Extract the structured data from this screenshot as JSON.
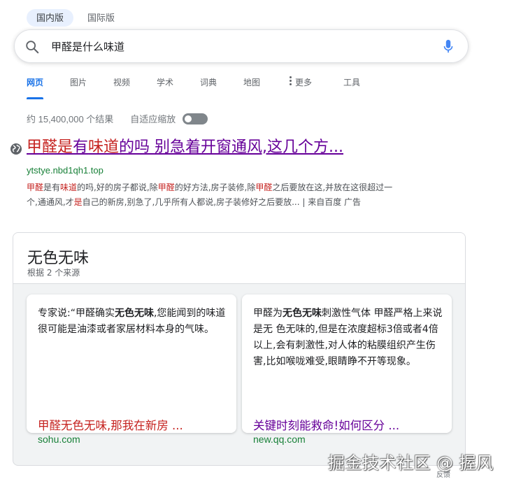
{
  "region_tabs": [
    {
      "label": "国内版",
      "active": true
    },
    {
      "label": "国际版",
      "active": false
    }
  ],
  "search": {
    "value": "甲醛是什么味道",
    "placeholder": ""
  },
  "vertical_tabs": [
    {
      "label": "网页",
      "active": true
    },
    {
      "label": "图片"
    },
    {
      "label": "视频"
    },
    {
      "label": "学术"
    },
    {
      "label": "词典"
    },
    {
      "label": "地图"
    },
    {
      "label": "更多"
    },
    {
      "label": "工具"
    }
  ],
  "stats": {
    "result_count": "约 15,400,000 个结果",
    "adaptive_zoom_label": "自适应缩放",
    "adaptive_zoom_on": false
  },
  "ad_result": {
    "title_parts": [
      "甲醛是",
      "有",
      "味道",
      "的吗 别急着开窗通风,这几个方..."
    ],
    "url": "ytstye.nbd1qh1.top",
    "snippet_line1": [
      "甲醛",
      "是有",
      "味道",
      "的吗,好的房子都说,除",
      "甲醛",
      "的好方法,房子装修,除",
      "甲醛",
      "之后要放在这,并放在这很超过一"
    ],
    "snippet_line2": [
      "个,通通风,才",
      "是",
      "自己的新房,别急了,几乎所有人都说,房子装修好之后要放... | 来自百度 广告"
    ]
  },
  "featured": {
    "title": "无色无味",
    "subtitle": "根据 2 个来源",
    "sources": [
      {
        "text_parts": [
          "专家说:“甲醛确实",
          "无色无味",
          ",您能闻到的味道很可能是油漆或者家居材料本身的气味。"
        ],
        "link": "甲醛无色无味,那我在新房 ...",
        "domain": "sohu.com"
      },
      {
        "text_parts": [
          "甲醛为",
          "无色无味",
          "刺激性气体 甲醛严格上来说是无 色无味的,但是在浓度超标3倍或者4倍以上,会有刺激性,对人体的粘膜组织产生伤害,比如喉咙难受,眼睛睁不开等现象。"
        ],
        "link": "关键时刻能救命!如何区分 ...",
        "domain": "new.qq.com"
      }
    ]
  },
  "watermark": "掘金技术社区 @ 握风",
  "feedback": "反馈",
  "colors": {
    "link_visited": "#660099",
    "highlight": "#c5221f",
    "url_green": "#188038",
    "accent_blue": "#1a73e8"
  }
}
